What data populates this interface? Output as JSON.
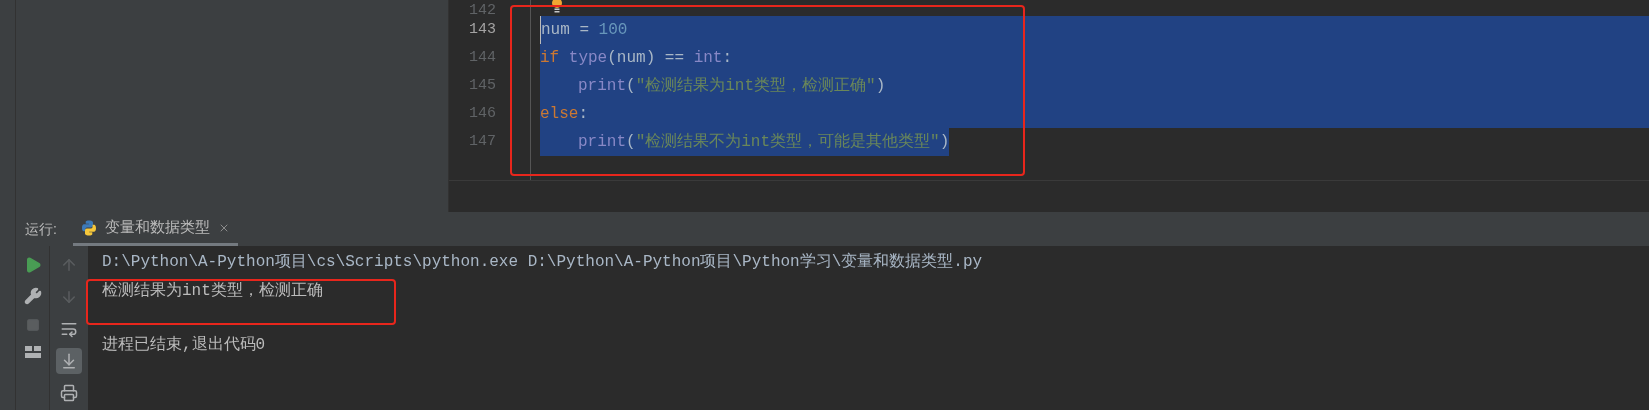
{
  "editor": {
    "lines": [
      {
        "number": "142",
        "current": false
      },
      {
        "number": "143",
        "current": true,
        "selected": true,
        "indented": false,
        "tokens": [
          {
            "text": "num = ",
            "kind": "plain"
          },
          {
            "text": "100",
            "kind": "number"
          }
        ]
      },
      {
        "number": "144",
        "current": false,
        "selected": true,
        "indented": false,
        "tokens": [
          {
            "text": "if ",
            "kind": "keyword"
          },
          {
            "text": "type",
            "kind": "builtin"
          },
          {
            "text": "(num) == ",
            "kind": "plain"
          },
          {
            "text": "int",
            "kind": "builtin"
          },
          {
            "text": ":",
            "kind": "plain"
          }
        ]
      },
      {
        "number": "145",
        "current": false,
        "selected": true,
        "indented": true,
        "tokens": [
          {
            "text": "print",
            "kind": "builtin"
          },
          {
            "text": "(",
            "kind": "plain"
          },
          {
            "text": "\"检测结果为int类型，检测正确\"",
            "kind": "string"
          },
          {
            "text": ")",
            "kind": "plain"
          }
        ]
      },
      {
        "number": "146",
        "current": false,
        "selected": true,
        "indented": false,
        "tokens": [
          {
            "text": "else",
            "kind": "keyword"
          },
          {
            "text": ":",
            "kind": "plain"
          }
        ]
      },
      {
        "number": "147",
        "current": false,
        "selected": true,
        "indented": true,
        "tokens": [
          {
            "text": "print",
            "kind": "builtin"
          },
          {
            "text": "(",
            "kind": "plain"
          },
          {
            "text": "\"检测结果不为int类型，可能是其他类型\"",
            "kind": "string"
          },
          {
            "text": ")",
            "kind": "plain"
          }
        ]
      }
    ]
  },
  "run_panel": {
    "label": "运行:",
    "tabs": [
      {
        "title": "变量和数据类型",
        "selected": true
      }
    ],
    "toolbar_left": [
      {
        "kind": "run",
        "disabled": false
      },
      {
        "kind": "wrench",
        "disabled": false
      },
      {
        "kind": "stop",
        "disabled": true
      },
      {
        "kind": "layout",
        "disabled": false
      }
    ],
    "toolbar_right": [
      {
        "kind": "up",
        "disabled": true,
        "selected": false
      },
      {
        "kind": "down",
        "disabled": true,
        "selected": false
      },
      {
        "kind": "wrap",
        "disabled": false,
        "selected": false
      },
      {
        "kind": "scroll-end",
        "disabled": false,
        "selected": true
      },
      {
        "kind": "print",
        "disabled": false,
        "selected": false
      }
    ],
    "console": [
      {
        "text": "D:\\Python\\A-Python项目\\cs\\Scripts\\python.exe D:\\Python\\A-Python项目\\Python学习\\变量和数据类型.py",
        "kind": "command"
      },
      {
        "text": "检测结果为int类型，检测正确",
        "kind": "output"
      },
      {
        "text": "进程已结束,退出代码0",
        "kind": "exit"
      }
    ]
  }
}
